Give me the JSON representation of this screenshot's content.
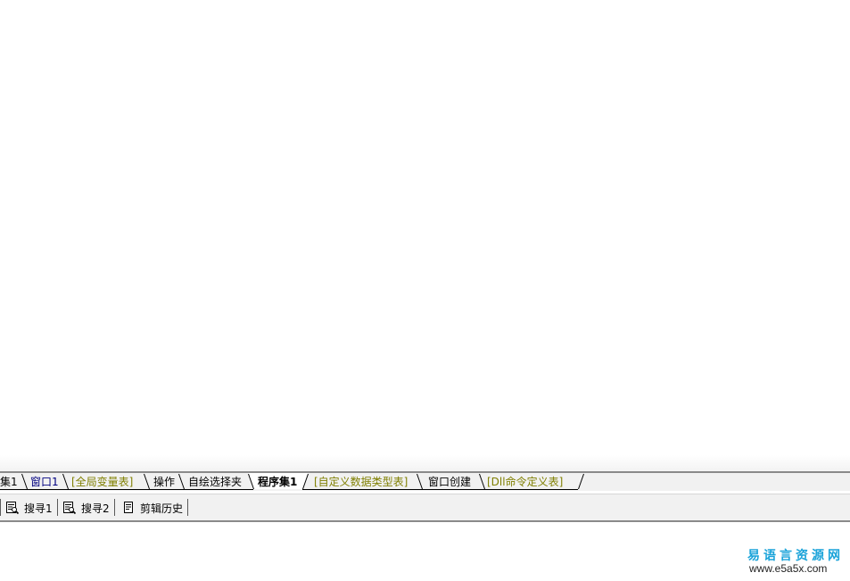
{
  "tabs": [
    {
      "label": "集1",
      "style": "normal"
    },
    {
      "label": "窗口1",
      "style": "blue"
    },
    {
      "label": "[全局变量表]",
      "style": "olive"
    },
    {
      "label": "操作",
      "style": "normal"
    },
    {
      "label": "自绘选择夹",
      "style": "normal"
    },
    {
      "label": "程序集1",
      "style": "active"
    },
    {
      "label": "[自定义数据类型表]",
      "style": "olive"
    },
    {
      "label": "窗口创建",
      "style": "normal"
    },
    {
      "label": "[Dll命令定义表]",
      "style": "olive"
    }
  ],
  "panel_tabs": [
    {
      "label": "搜寻1",
      "icon": "search-list-icon"
    },
    {
      "label": "搜寻2",
      "icon": "search-list-icon"
    },
    {
      "label": "剪辑历史",
      "icon": "clip-history-icon"
    }
  ],
  "watermark": {
    "title": "易语言资源网",
    "url": "www.e5a5x.com"
  },
  "colors": {
    "olive_tab_text": "#7f7f00",
    "blue_tab_text": "#000080",
    "watermark_blue": "#1aa3d9"
  }
}
